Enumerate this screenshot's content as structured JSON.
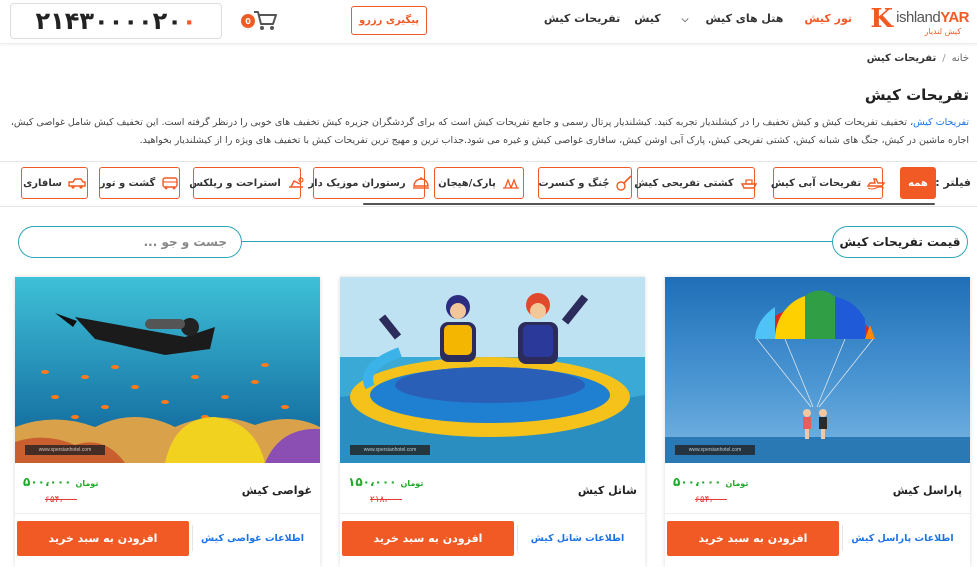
{
  "header": {
    "logo_text_k": "K",
    "logo_text_rest": "ishland",
    "logo_text_yar": "YAR",
    "logo_sub": "کیش لندیار",
    "nav": [
      {
        "label": "تور کیش",
        "active": true
      },
      {
        "label": "هتل های کیش",
        "dropdown": true
      },
      {
        "label": "کیش"
      },
      {
        "label": "تفریحات کیش"
      }
    ],
    "track_label": "پیگیری رزرو",
    "cart_count": "0",
    "phone_prefix": "۰",
    "phone_rest": "۲۱۴۳۰۰۰۰۲۰"
  },
  "breadcrumb": {
    "home": "خانه",
    "separator": "/",
    "current": "تفریحات کیش"
  },
  "page_title": "تفریحات کیش",
  "intro": {
    "link": "تفریحات کیش",
    "text": "، تخفیف تفریحات کیش و کیش تخفیف را در کیشلندیار تجربه کنید. کیشلندیار پرتال رسمی و جامع تفریحات کیش است که برای گردشگران جزیره کیش تخفیف های خوبی را درنظر گرفته است. این تخفیف کیش شامل غواصی کیش، اجاره ماشین در کیش، جنگ های شبانه کیش، کشتی تفریحی کیش، پارک آبی اوشن کیش، سافاری غواصی کیش و غیره می شود.جذاب ترین و مهیج ترین تفریحات کیش با تخفیف های ویژه را از کیشلندیار بخواهید."
  },
  "filters": {
    "label": "فیلتر :",
    "chips": [
      {
        "label": "همه",
        "active": true,
        "icon": "all"
      },
      {
        "label": "تفریحات آبی کیش",
        "icon": "jetski-icon"
      },
      {
        "label": "کشتی تفریحی کیش",
        "icon": "ship-icon"
      },
      {
        "label": "جُنگ و کنسرت",
        "icon": "guitar-icon"
      },
      {
        "label": "پارک/هیجان",
        "icon": "ride-icon"
      },
      {
        "label": "رستوران موزیک دار",
        "icon": "dish-icon"
      },
      {
        "label": "استراحت و ریلکس",
        "icon": "relax-icon"
      },
      {
        "label": "گشت و تور",
        "icon": "bus-icon"
      },
      {
        "label": "سافاری",
        "icon": "jeep-icon"
      }
    ]
  },
  "section": {
    "title": "قیمت تفریحات کیش",
    "search_placeholder": "جست و جو ..."
  },
  "cards": [
    {
      "name": "پاراسل کیش",
      "price": "۵۰۰،۰۰۰",
      "unit": "تومان",
      "old_price": "۶۵۴،۰۰۰",
      "info": "اطلاعات پاراسل کیش",
      "add": "افزودن به سبد خرید",
      "watermark": "www.xpersianhotel.com"
    },
    {
      "name": "شاتل کیش",
      "price": "۱۵۰،۰۰۰",
      "unit": "تومان",
      "old_price": "۲۱۸،۰۰۰",
      "info": "اطلاعات شاتل کیش",
      "add": "افزودن به سبد خرید",
      "watermark": "www.xpersianhotel.com"
    },
    {
      "name": "غواصی کیش",
      "price": "۵۰۰،۰۰۰",
      "unit": "تومان",
      "old_price": "۶۵۴،۰۰۰",
      "info": "اطلاعات غواصی کیش",
      "add": "افزودن به سبد خرید",
      "watermark": "www.xpersianhotel.com"
    }
  ],
  "colors": {
    "accent": "#f15a24",
    "price_green": "#1faa2a",
    "teal": "#2aa6b8",
    "link_blue": "#1a73e8"
  }
}
